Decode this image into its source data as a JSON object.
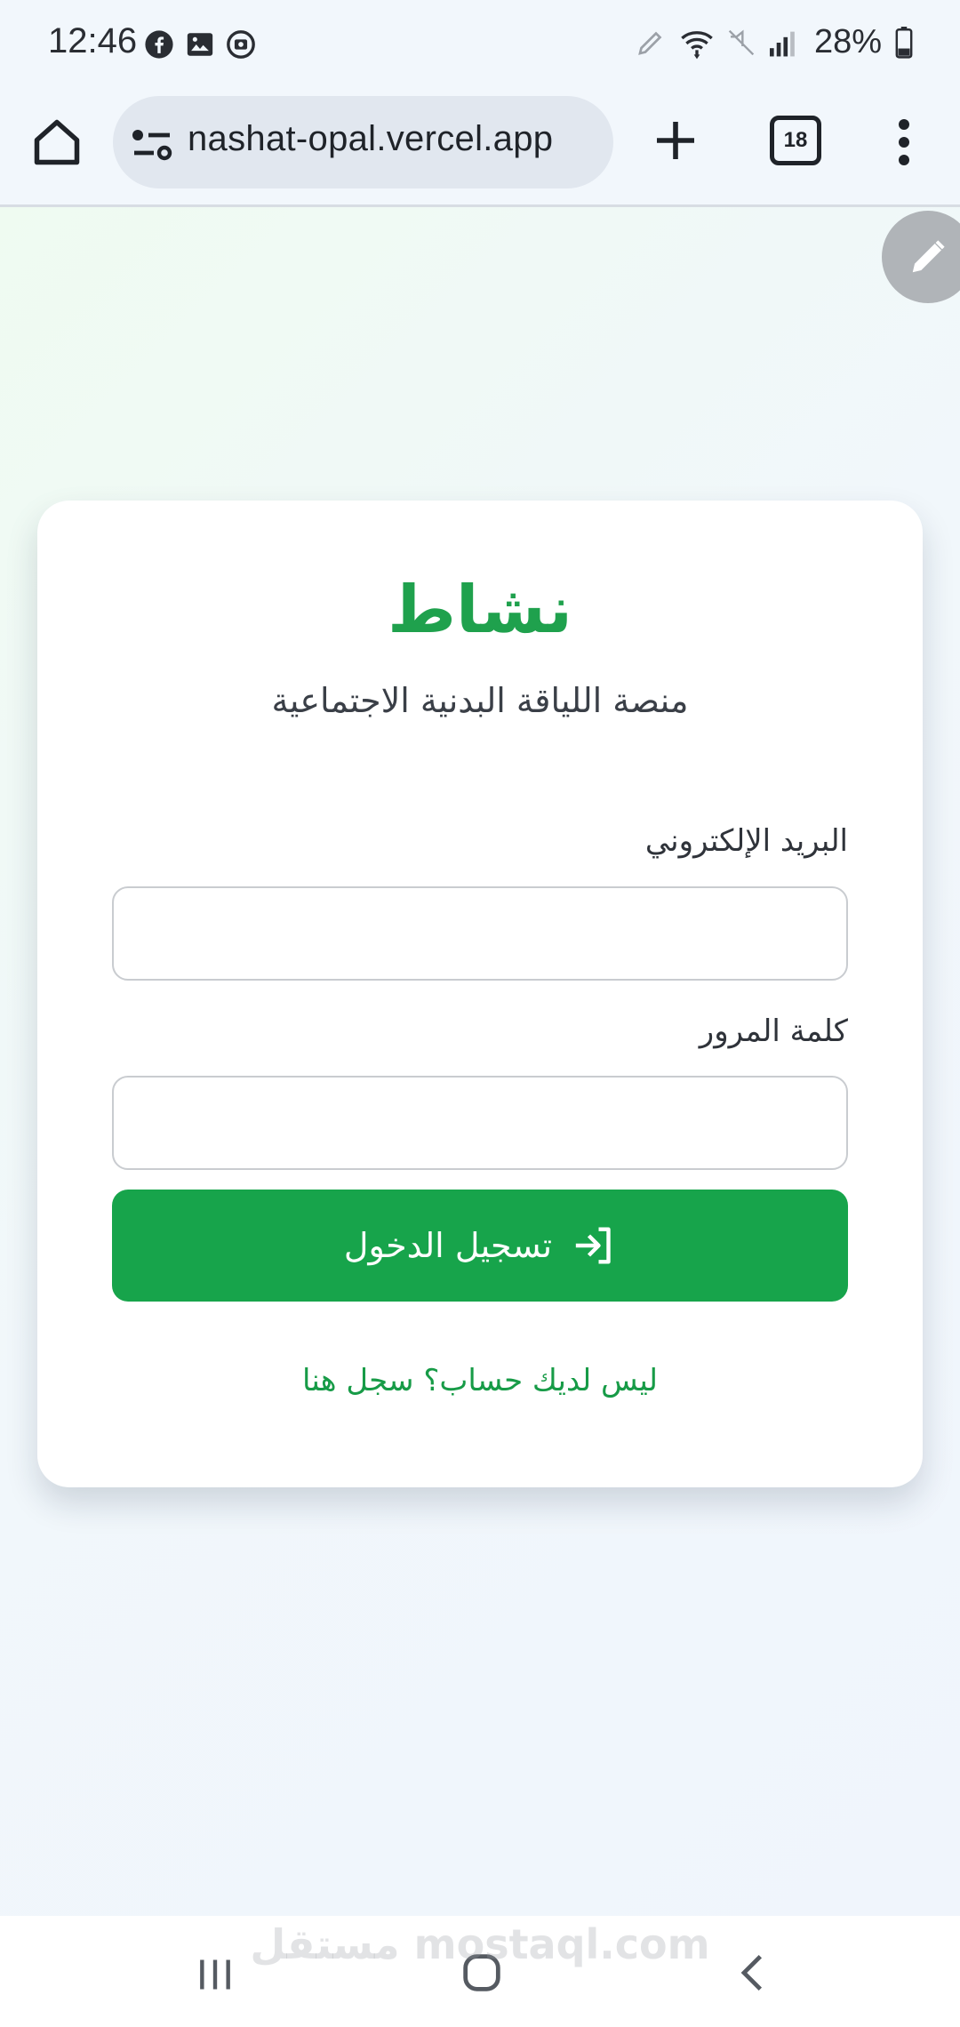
{
  "status_bar": {
    "time": "12:46",
    "battery": "28%",
    "left_icons": [
      "facebook-icon",
      "image-icon",
      "media-icon"
    ],
    "right_icons": [
      "pen-icon",
      "wifi-icon",
      "mute-icon",
      "signal-icon",
      "battery-icon"
    ]
  },
  "browser": {
    "url": "nashat-opal.vercel.app",
    "tab_count": "18"
  },
  "login_card": {
    "title": "نشاط",
    "subtitle": "منصة اللياقة البدنية الاجتماعية",
    "email_label": "البريد الإلكتروني",
    "email_value": "",
    "password_label": "كلمة المرور",
    "password_value": "",
    "login_button": "تسجيل الدخول",
    "register_link": "ليس لديك حساب؟ سجل هنا"
  },
  "watermark": "مستقل mostaql.com",
  "colors": {
    "brand_green": "#17a44b",
    "title_green": "#1fa14d",
    "link_green": "#179b47"
  }
}
